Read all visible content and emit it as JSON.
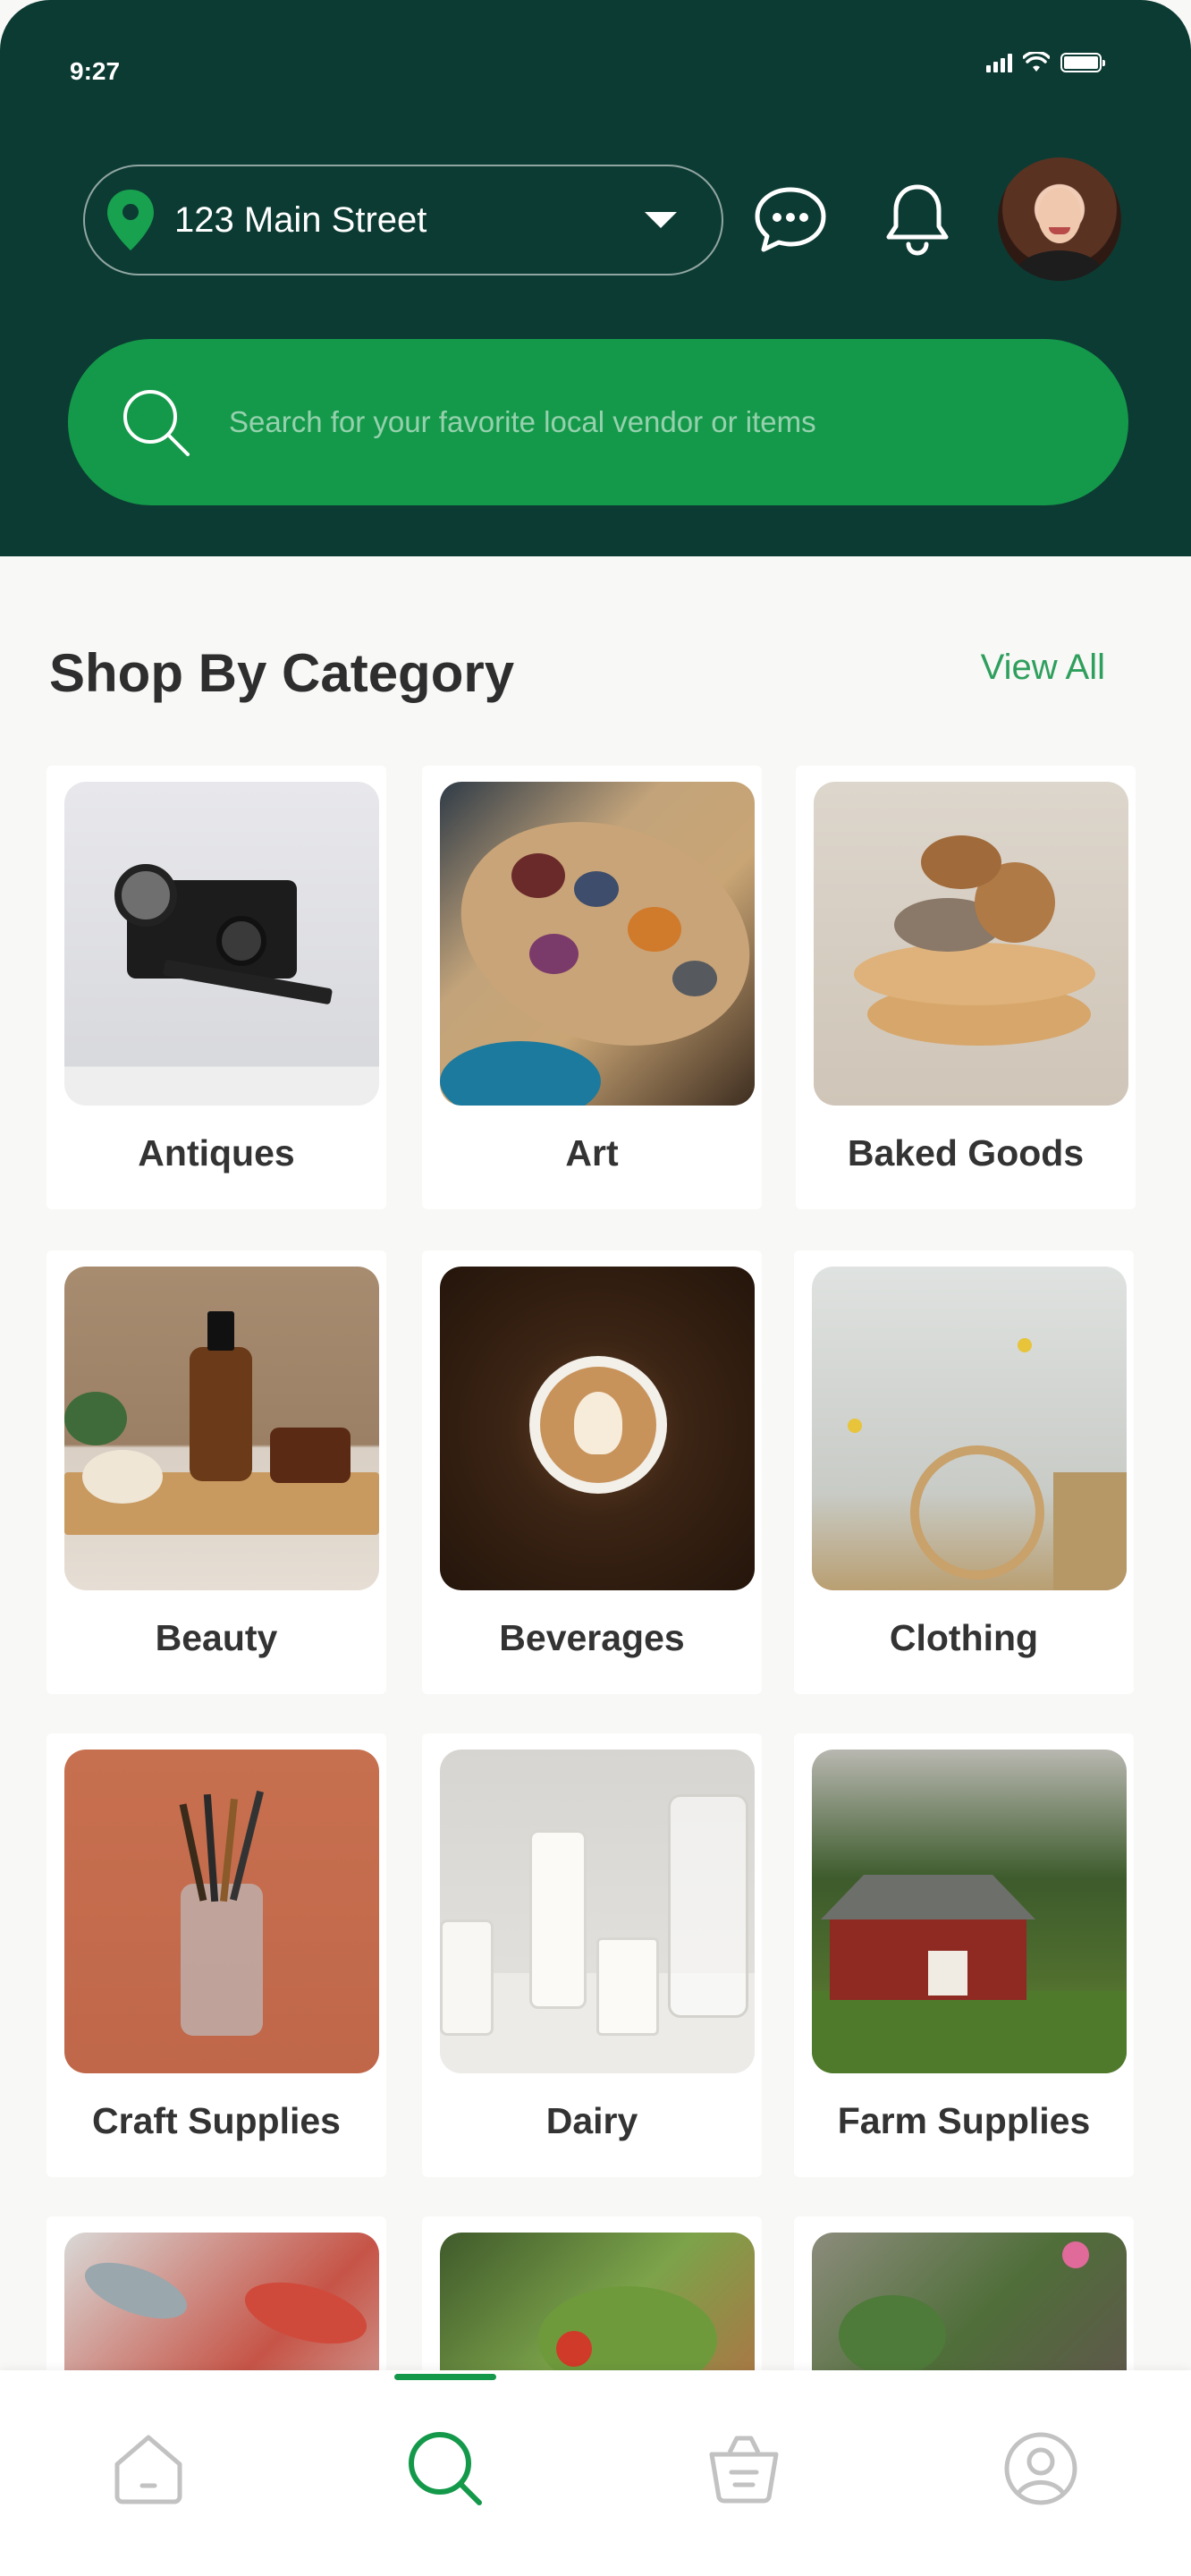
{
  "status_bar": {
    "time": "9:27"
  },
  "header": {
    "location": "123 Main Street"
  },
  "search": {
    "placeholder": "Search for your favorite local vendor or items"
  },
  "section": {
    "title": "Shop By Category",
    "view_all": "View All"
  },
  "categories": [
    {
      "label": "Antiques"
    },
    {
      "label": "Art"
    },
    {
      "label": "Baked Goods"
    },
    {
      "label": "Beauty"
    },
    {
      "label": "Beverages"
    },
    {
      "label": "Clothing"
    },
    {
      "label": "Craft Supplies"
    },
    {
      "label": "Dairy"
    },
    {
      "label": "Farm Supplies"
    }
  ],
  "bottom_nav": [
    {
      "icon": "home-icon",
      "active": false
    },
    {
      "icon": "search-icon",
      "active": true
    },
    {
      "icon": "basket-icon",
      "active": false
    },
    {
      "icon": "profile-icon",
      "active": false
    }
  ],
  "colors": {
    "header_bg": "#0c3b33",
    "accent_green": "#14994a",
    "link_green": "#2f9f5d"
  }
}
